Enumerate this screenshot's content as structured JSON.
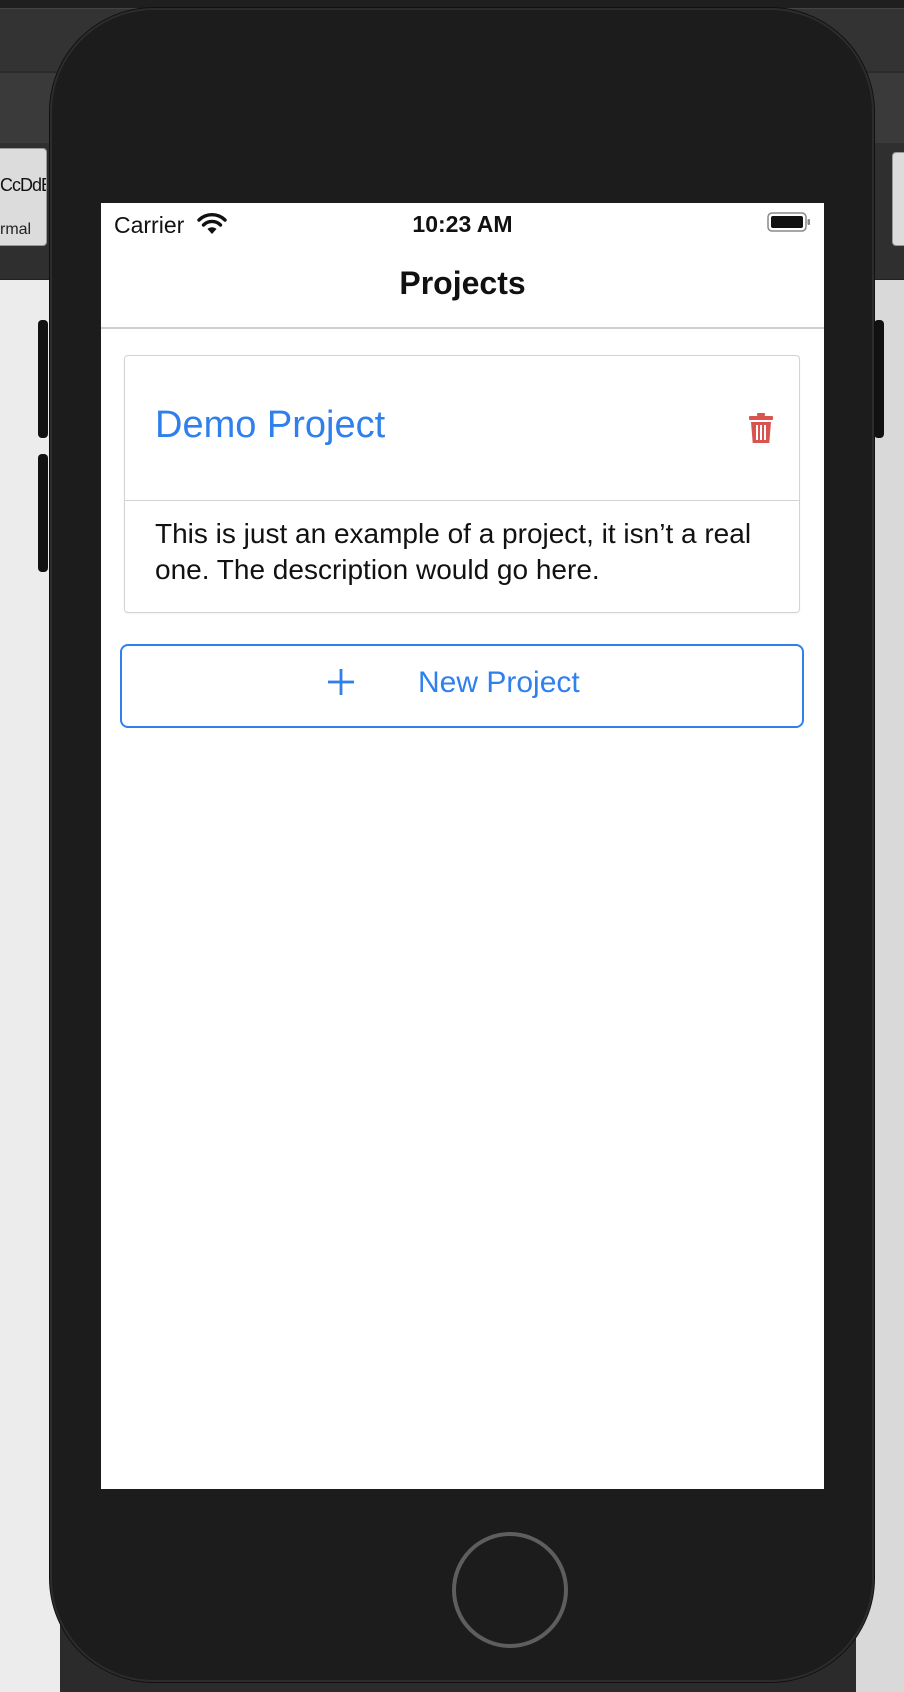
{
  "background": {
    "ribbon_text_a": "CcDdE",
    "ribbon_text_b": "rmal"
  },
  "status_bar": {
    "carrier": "Carrier",
    "time": "10:23 AM",
    "wifi_icon": "wifi-icon",
    "battery_icon": "battery-icon"
  },
  "nav": {
    "title": "Projects"
  },
  "projects": [
    {
      "name": "Demo Project",
      "description": "This is just an example of a project, it isn’t a real one. The description would go here.",
      "delete_icon": "trash-icon"
    }
  ],
  "new_project_button": {
    "icon": "plus-icon",
    "label": "New Project"
  },
  "colors": {
    "accent": "#2f80ed",
    "danger": "#d9534f",
    "device_body": "#1c1c1c"
  }
}
